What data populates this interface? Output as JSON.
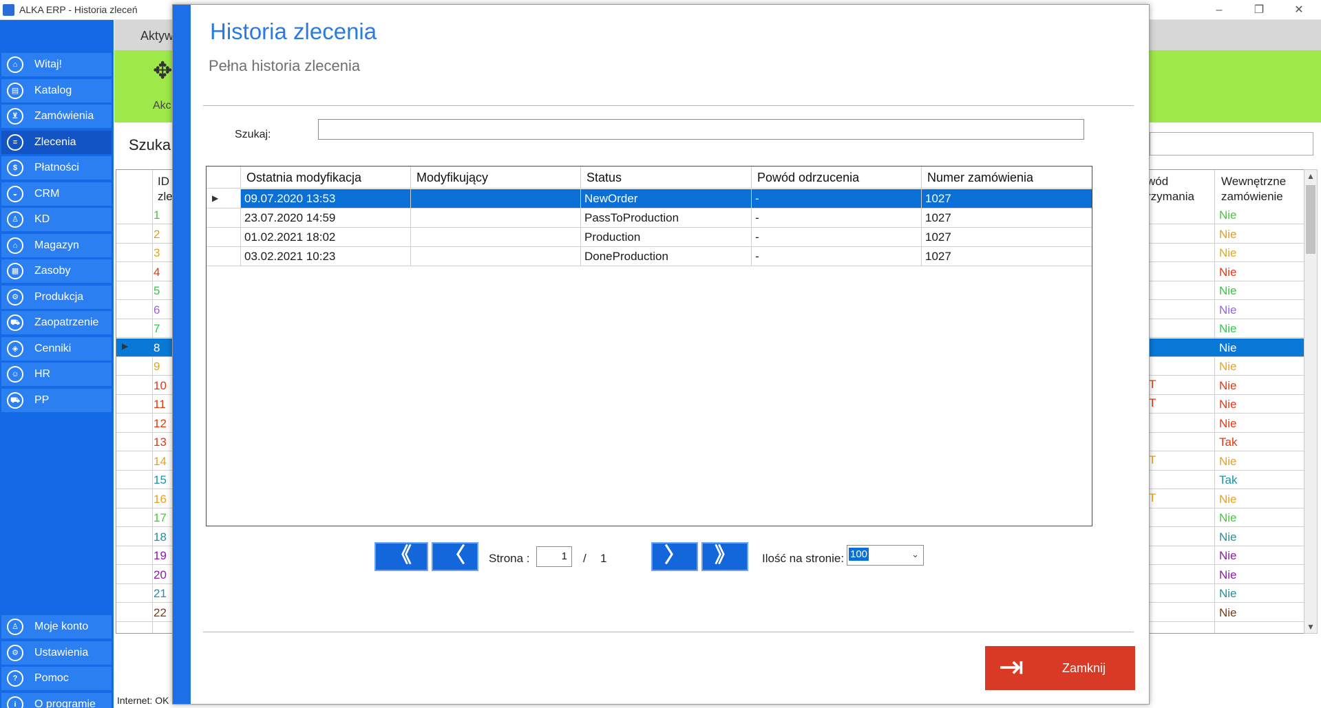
{
  "window": {
    "title": "ALKA ERP - Historia zleceń"
  },
  "sidebar": {
    "items": [
      {
        "label": "Witaj!",
        "icon": "home-icon",
        "glyph": "⌂"
      },
      {
        "label": "Katalog",
        "icon": "book-icon",
        "glyph": "▤"
      },
      {
        "label": "Zamówienia",
        "icon": "cart-icon",
        "glyph": "⊻"
      },
      {
        "label": "Zlecenia",
        "icon": "list-icon",
        "glyph": "≡"
      },
      {
        "label": "Płatności",
        "icon": "dollar-icon",
        "glyph": "$"
      },
      {
        "label": "CRM",
        "icon": "crm-icon",
        "glyph": "◒"
      },
      {
        "label": "KD",
        "icon": "person-icon",
        "glyph": "♙"
      },
      {
        "label": "Magazyn",
        "icon": "warehouse-icon",
        "glyph": "⌂"
      },
      {
        "label": "Zasoby",
        "icon": "resources-icon",
        "glyph": "▦"
      },
      {
        "label": "Produkcja",
        "icon": "production-icon",
        "glyph": "⚙"
      },
      {
        "label": "Zaopatrzenie",
        "icon": "truck-icon",
        "glyph": "⛟"
      },
      {
        "label": "Cenniki",
        "icon": "tag-icon",
        "glyph": "◈"
      },
      {
        "label": "HR",
        "icon": "hr-icon",
        "glyph": "☺"
      },
      {
        "label": "PP",
        "icon": "pp-icon",
        "glyph": "⛟"
      }
    ],
    "bottom_items": [
      {
        "label": "Moje konto",
        "icon": "account-icon",
        "glyph": "♙"
      },
      {
        "label": "Ustawienia",
        "icon": "settings-icon",
        "glyph": "⚙"
      },
      {
        "label": "Pomoc",
        "icon": "help-icon",
        "glyph": "?"
      },
      {
        "label": "O programie",
        "icon": "info-icon",
        "glyph": "i"
      }
    ],
    "active_index": 3
  },
  "background": {
    "tab_label": "Aktyw",
    "action_label": "Akc",
    "search_label": "Szuka",
    "grid_header": {
      "id_col": "ID\nzle",
      "reason_col": "wód\nrzymania",
      "internal_col": "Wewnętrzne\nzamówienie"
    },
    "rows": [
      {
        "id": "1",
        "mark": "",
        "internal": "Nie",
        "color": "#44c83a"
      },
      {
        "id": "2",
        "mark": "",
        "internal": "Nie",
        "color": "#e39a1e"
      },
      {
        "id": "3",
        "mark": "",
        "internal": "Nie",
        "color": "#e0a820"
      },
      {
        "id": "4",
        "mark": "",
        "internal": "Nie",
        "color": "#e8350f"
      },
      {
        "id": "5",
        "mark": "",
        "internal": "Nie",
        "color": "#34c83a"
      },
      {
        "id": "6",
        "mark": "",
        "internal": "Nie",
        "color": "#9a5ee6"
      },
      {
        "id": "7",
        "mark": "",
        "internal": "Nie",
        "color": "#2fc84a"
      },
      {
        "id": "8",
        "mark": "",
        "internal": "Nie",
        "color": "#ffffff",
        "selected": true
      },
      {
        "id": "9",
        "mark": "",
        "internal": "Nie",
        "color": "#e6a21e"
      },
      {
        "id": "10",
        "mark": "T",
        "internal": "Nie",
        "color": "#e8350f"
      },
      {
        "id": "11",
        "mark": "T",
        "internal": "Nie",
        "color": "#e8350f"
      },
      {
        "id": "12",
        "mark": "",
        "internal": "Nie",
        "color": "#e8350f"
      },
      {
        "id": "13",
        "mark": "",
        "internal": "Tak",
        "color": "#e8350f"
      },
      {
        "id": "14",
        "mark": "T",
        "internal": "Nie",
        "color": "#e6a21e"
      },
      {
        "id": "15",
        "mark": "",
        "internal": "Tak",
        "color": "#1f8ea6"
      },
      {
        "id": "16",
        "mark": "T",
        "internal": "Nie",
        "color": "#e6a21e"
      },
      {
        "id": "17",
        "mark": "",
        "internal": "Nie",
        "color": "#44c83a"
      },
      {
        "id": "18",
        "mark": "",
        "internal": "Nie",
        "color": "#1f8ea6"
      },
      {
        "id": "19",
        "mark": "",
        "internal": "Nie",
        "color": "#8a1aa0"
      },
      {
        "id": "20",
        "mark": "",
        "internal": "Nie",
        "color": "#8a1aa0"
      },
      {
        "id": "21",
        "mark": "",
        "internal": "Nie",
        "color": "#1f8ea6"
      },
      {
        "id": "22",
        "mark": "",
        "internal": "Nie",
        "color": "#7a3a10"
      }
    ],
    "status_bar": "Internet: OK"
  },
  "modal": {
    "title": "Historia zlecenia",
    "subtitle": "Pełna historia zlecenia",
    "search_label": "Szukaj:",
    "search_value": "",
    "columns": [
      "Ostatnia modyfikacja",
      "Modyfikujący",
      "Status",
      "Powód odrzucenia",
      "Numer zamówienia"
    ],
    "rows": [
      [
        "09.07.2020 13:53",
        "",
        "NewOrder",
        "-",
        "1027"
      ],
      [
        "23.07.2020 14:59",
        "",
        "PassToProduction",
        "-",
        "1027"
      ],
      [
        "01.02.2021 18:02",
        "",
        "Production",
        "-",
        "1027"
      ],
      [
        "03.02.2021 10:23",
        "",
        "DoneProduction",
        "-",
        "1027"
      ]
    ],
    "selected_row": 0,
    "pager": {
      "first_glyph": "《",
      "prev_glyph": "〈",
      "next_glyph": "〉",
      "last_glyph": "》",
      "page_label": "Strona :",
      "page_value": "1",
      "separator": "/",
      "total_pages": "1",
      "per_page_label": "Ilość na stronie:",
      "per_page_value": "100"
    },
    "close_label": "Zamknij"
  },
  "colors": {
    "accent": "#1c6fe6",
    "title_blue": "#2a7ae0",
    "selection": "#0a6fd6",
    "close_red": "#d83a26",
    "toolbar_green": "#9ee84a"
  }
}
